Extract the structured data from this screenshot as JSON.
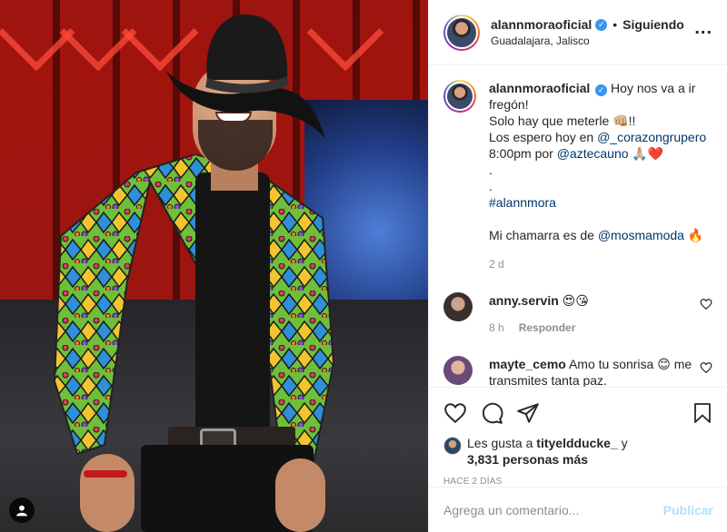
{
  "post": {
    "author": {
      "username": "alannmoraoficial",
      "verified": true,
      "follow_status": "Siguiendo",
      "separator": "•",
      "location": "Guadalajara, Jalisco"
    },
    "more_label": "...",
    "caption": {
      "line1": "Hoy nos va a ir fregón!",
      "line2": "Solo hay que meterle 👊🏼!!",
      "line3_prefix": "Los espero hoy en ",
      "line3_mention": "@_corazongrupero",
      "line4_prefix": "8:00pm por ",
      "line4_mention": "@aztecauno",
      "line4_suffix": " 🙏🏼❤️",
      "dot1": ".",
      "dot2": ".",
      "hashtag": "#alannmora",
      "line7_prefix": "Mi chamarra es de ",
      "line7_mention": "@mosmamoda",
      "line7_suffix": " 🔥"
    },
    "caption_time": "2 d",
    "comments": [
      {
        "username": "anny.servin",
        "text": "😍😘",
        "time": "8 h",
        "reply": "Responder"
      },
      {
        "username": "mayte_cemo",
        "text": "Amo tu sonrisa 😊 me transmites tanta paz."
      }
    ],
    "likes": {
      "prefix": "Les gusta a ",
      "user": "tityeldducke_",
      "conj": " y",
      "count": "3,831 personas más"
    },
    "posted_ago": "HACE 2 DÍAS",
    "add_comment": {
      "placeholder": "Agrega un comentario...",
      "publish_label": "Publicar"
    },
    "colors": {
      "link": "#00376b",
      "muted": "#8e8e8e",
      "verified": "#3897f0",
      "publish_disabled": "#b2dffc"
    },
    "icons": [
      "heart-icon",
      "comment-icon",
      "share-icon",
      "bookmark-icon",
      "user-tag-icon",
      "more-icon",
      "verified-icon"
    ]
  }
}
